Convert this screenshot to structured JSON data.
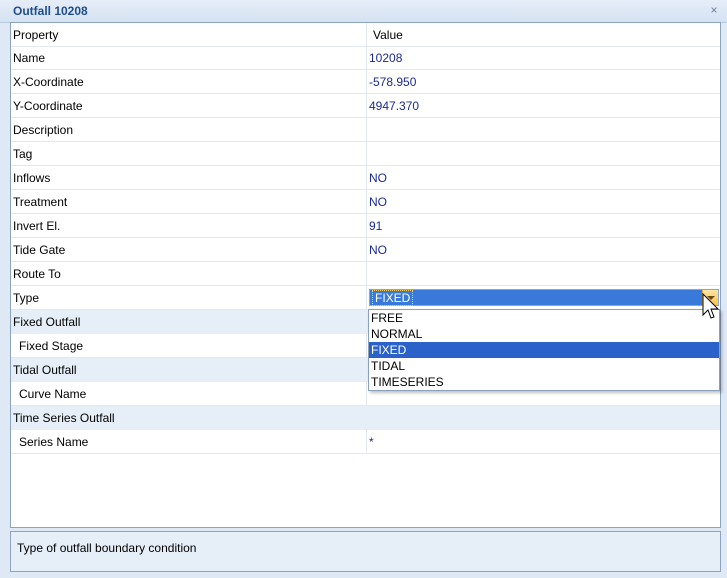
{
  "window": {
    "title": "Outfall 10208",
    "close_glyph": "×"
  },
  "grid": {
    "header": {
      "property": "Property",
      "value": "Value"
    },
    "rows": [
      {
        "name": "Name",
        "value": "10208"
      },
      {
        "name": "X-Coordinate",
        "value": "-578.950"
      },
      {
        "name": "Y-Coordinate",
        "value": "4947.370"
      },
      {
        "name": "Description",
        "value": ""
      },
      {
        "name": "Tag",
        "value": ""
      },
      {
        "name": "Inflows",
        "value": "NO"
      },
      {
        "name": "Treatment",
        "value": "NO"
      },
      {
        "name": "Invert El.",
        "value": "91"
      },
      {
        "name": "Tide Gate",
        "value": "NO"
      },
      {
        "name": "Route To",
        "value": ""
      },
      {
        "name": "Type",
        "value": "FIXED"
      },
      {
        "name": "Fixed Outfall",
        "value": ""
      },
      {
        "name": "Fixed Stage",
        "value": ""
      },
      {
        "name": "Tidal Outfall",
        "value": ""
      },
      {
        "name": "Curve Name",
        "value": ""
      },
      {
        "name": "Time Series Outfall",
        "value": ""
      },
      {
        "name": "Series Name",
        "value": "*"
      }
    ]
  },
  "type_dropdown": {
    "selected": "FIXED",
    "options": [
      "FREE",
      "NORMAL",
      "FIXED",
      "TIDAL",
      "TIMESERIES"
    ]
  },
  "description": {
    "text": "Type of outfall boundary condition"
  },
  "colors": {
    "accent": "#1f4e8c",
    "value_text": "#1c2a8f",
    "selection": "#2a62c9",
    "category_bg": "#e6eef8"
  }
}
